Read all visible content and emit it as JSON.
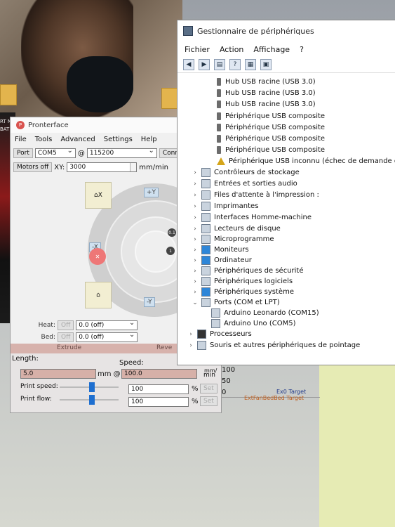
{
  "desktop": {
    "left_text": "RT N\nBAT"
  },
  "pronterface": {
    "title": "Pronterface",
    "menu": [
      "File",
      "Tools",
      "Advanced",
      "Settings",
      "Help"
    ],
    "port_label": "Port",
    "port_value": "COM5",
    "at_symbol": "@",
    "baud_value": "115200",
    "connect_label": "Connec",
    "motors_off_label": "Motors off",
    "xy_label": "XY:",
    "xy_value": "3000",
    "xy_unit": "mm/min",
    "jog": {
      "plus_y": "+Y",
      "minus_y": "-Y",
      "minus_x": "-X",
      "home_x": "X",
      "zero_one": "0.1",
      "one": "1"
    },
    "heat_label": "Heat:",
    "heat_off": "Off",
    "heat_value": "0.0 (off)",
    "bed_label": "Bed:",
    "bed_off": "Off",
    "bed_value": "0.0 (off)",
    "extrude_label": "Extrude",
    "reverse_label": "Reve",
    "length_label": "Length:",
    "speed_label": "Speed:",
    "length_value": "5.0",
    "mm_at": "mm @",
    "speed_value": "100.0",
    "speed_unit_1": "mm/",
    "speed_unit_2": "min",
    "print_speed_label": "Print speed:",
    "print_flow_label": "Print flow:",
    "print_speed_value": "100",
    "print_flow_value": "100",
    "percent": "%",
    "set_label": "Set",
    "graph_labels": {
      "y_100": "100",
      "y_50": "50",
      "y_0": "0",
      "legend_1": "Ex0 Target",
      "legend_2": "ExtFanBedBed Target"
    },
    "print_speed_level": 0.55,
    "print_flow_level": 0.55
  },
  "device_manager": {
    "title": "Gestionnaire de périphériques",
    "menu": [
      "Fichier",
      "Action",
      "Affichage",
      "?"
    ],
    "usb_items": [
      "Hub USB racine (USB 3.0)",
      "Hub USB racine (USB 3.0)",
      "Hub USB racine (USB 3.0)",
      "Périphérique USB composite",
      "Périphérique USB composite",
      "Périphérique USB composite",
      "Périphérique USB composite",
      "Périphérique USB inconnu (échec de demande de d"
    ],
    "categories": [
      "Contrôleurs de stockage",
      "Entrées et sorties audio",
      "Files d'attente à l'impression :",
      "Imprimantes",
      "Interfaces Homme-machine",
      "Lecteurs de disque",
      "Microprogramme",
      "Moniteurs",
      "Ordinateur",
      "Périphériques de sécurité",
      "Périphériques logiciels",
      "Périphériques système",
      "Ports (COM et LPT)"
    ],
    "ports_children": [
      "Arduino Leonardo (COM15)",
      "Arduino Uno (COM5)"
    ],
    "tail_categories": [
      "Processeurs",
      "Souris et autres périphériques de pointage"
    ]
  }
}
